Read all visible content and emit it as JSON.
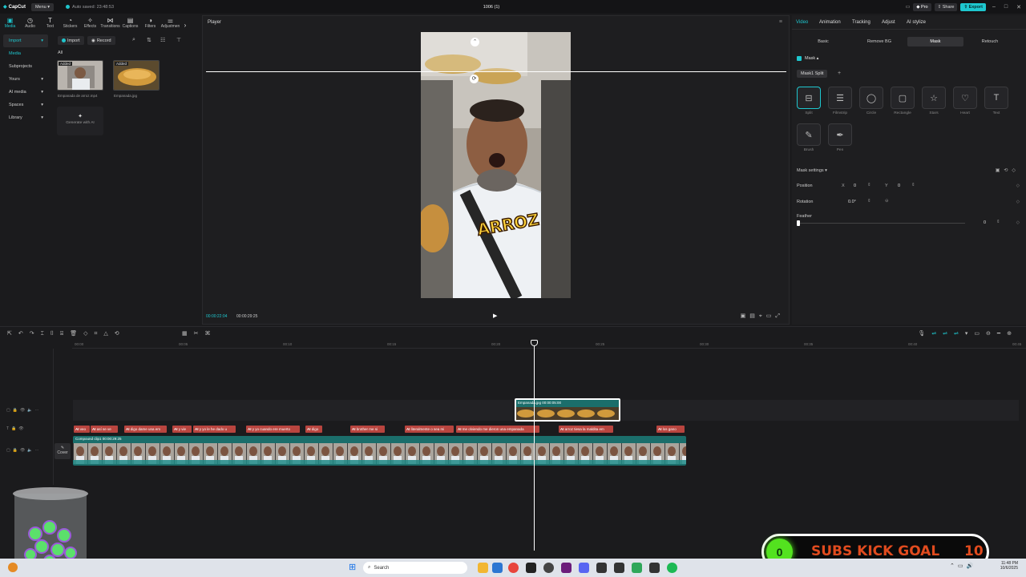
{
  "titlebar": {
    "logo": "CapCut",
    "menu": "Menu",
    "autosave": "Auto saved: 23:48:53",
    "title": "1006 (1)",
    "pro": "Pro",
    "share": "Share",
    "export": "Export"
  },
  "toolbar": {
    "tools": [
      {
        "label": "Media",
        "icon": "media-icon"
      },
      {
        "label": "Audio",
        "icon": "audio-icon"
      },
      {
        "label": "Text",
        "icon": "text-icon"
      },
      {
        "label": "Stickers",
        "icon": "stickers-icon"
      },
      {
        "label": "Effects",
        "icon": "effects-icon"
      },
      {
        "label": "Transitions",
        "icon": "transitions-icon"
      },
      {
        "label": "Captions",
        "icon": "captions-icon"
      },
      {
        "label": "Filters",
        "icon": "filters-icon"
      },
      {
        "label": "Adjustmen",
        "icon": "adjust-icon"
      }
    ]
  },
  "leftnav": {
    "items": [
      "Import",
      "Media",
      "Subprojects",
      "Yours",
      "AI media",
      "Spaces",
      "Library"
    ]
  },
  "media": {
    "import": "Import",
    "record": "Record",
    "filter": "All",
    "items": [
      {
        "name": "Empanada de arroz.mp4",
        "badge": "Added"
      },
      {
        "name": "Empanada.jpg",
        "badge": "Added"
      }
    ],
    "generate": "Generate with AI"
  },
  "player": {
    "title": "Player",
    "current_time": "00:00:22:04",
    "total_time": "00:00:29:25",
    "overlay_text": "ARROZ"
  },
  "rpanel": {
    "tabs": [
      "Video",
      "Animation",
      "Tracking",
      "Adjust",
      "AI stylize"
    ],
    "subtabs": [
      "Basic",
      "Remove BG",
      "Mask",
      "Retouch"
    ],
    "mask_label": "Mask",
    "mask_name": "Mask1 Split",
    "shapes": [
      {
        "label": "Split",
        "icon": "split-mask-icon"
      },
      {
        "label": "Filmstrip",
        "icon": "filmstrip-mask-icon"
      },
      {
        "label": "Circle",
        "icon": "circle-mask-icon"
      },
      {
        "label": "Rectangle",
        "icon": "rectangle-mask-icon"
      },
      {
        "label": "Stars",
        "icon": "star-mask-icon"
      },
      {
        "label": "Heart",
        "icon": "heart-mask-icon"
      },
      {
        "label": "Text",
        "icon": "text-mask-icon"
      },
      {
        "label": "Brush",
        "icon": "brush-mask-icon"
      },
      {
        "label": "Pen",
        "icon": "pen-mask-icon"
      }
    ],
    "settings_label": "Mask settings",
    "position_label": "Position",
    "pos_x_label": "X",
    "pos_x": "0",
    "pos_y_label": "Y",
    "pos_y": "0",
    "rotation_label": "Rotation",
    "rotation": "0.0°",
    "feather_label": "Feather",
    "feather": "0"
  },
  "timeline": {
    "ruler": [
      "00:00",
      "00:05",
      "00:10",
      "00:15",
      "00:20",
      "00:25",
      "00:30",
      "00:35",
      "00:40",
      "00:45"
    ],
    "overlay_clip": "Empanada.jpg   00:00:05:00",
    "main_clip": "Compound clip1   00:00:29:25",
    "cover": "Cover",
    "captions": [
      "veo",
      "así se ve",
      "digo dame una em",
      "y vie",
      "y yo le he dado u",
      "y yo cuando ere muerto",
      "digo",
      "brother me si",
      "literalmente o sea mi",
      "me olviendo me dieron una empanada",
      "arroz tiesa la maldita em",
      "los gano"
    ]
  },
  "taskbar": {
    "search": "Search",
    "time": "11:48 PM",
    "date": "10/6/2025"
  },
  "subs": {
    "count_left": "0",
    "label": "SUBS KICK GOAL",
    "count_right": "10"
  },
  "colors": {
    "accent": "#1ec7cf",
    "caption": "#b9453f",
    "clip": "#1b6e6b"
  }
}
